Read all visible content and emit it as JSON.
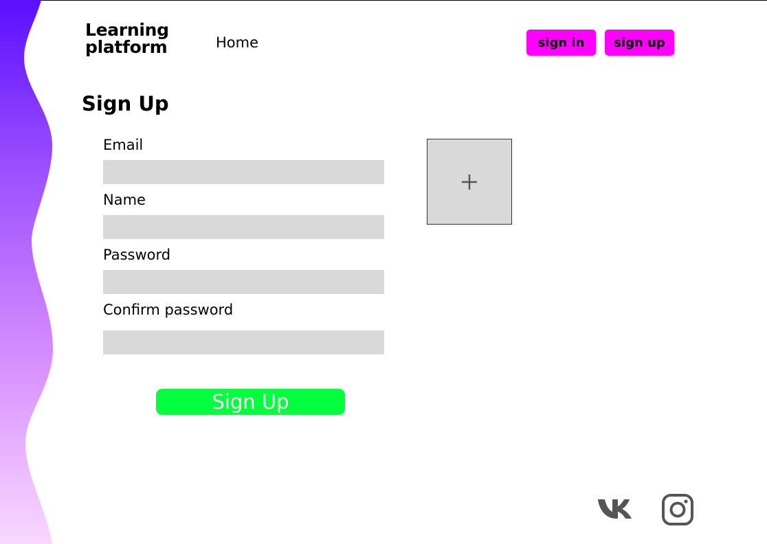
{
  "header": {
    "logo_line1": "Learning",
    "logo_line2": "platform",
    "nav_home": "Home",
    "signin_label": "sign in",
    "signup_label": "sign up"
  },
  "form": {
    "title": "Sign Up",
    "email_label": "Email",
    "email_value": "",
    "name_label": "Name",
    "name_value": "",
    "password_label": "Password",
    "password_value": "",
    "confirm_label": "Confirm password",
    "confirm_value": "",
    "submit_label": "Sign Up"
  },
  "avatar": {
    "icon": "plus-icon"
  },
  "social": [
    {
      "icon": "vk-icon"
    },
    {
      "icon": "instagram-icon"
    }
  ],
  "colors": {
    "accent_magenta": "#ff00ff",
    "submit_green": "#00ff3c",
    "field_gray": "#d9d9d9",
    "wave_top": "#5b10ff",
    "wave_bottom": "#f7d6ff"
  }
}
